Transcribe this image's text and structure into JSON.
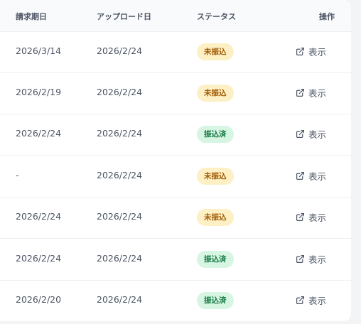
{
  "table": {
    "headers": {
      "due_date": "請求期日",
      "upload_date": "アップロード日",
      "status": "ステータス",
      "actions": "操作"
    },
    "rows": [
      {
        "due_date": "2026/3/14",
        "upload_date": "2026/2/24",
        "status": "未振込",
        "status_kind": "pending",
        "action_label": "表示"
      },
      {
        "due_date": "2026/2/19",
        "upload_date": "2026/2/24",
        "status": "未振込",
        "status_kind": "pending",
        "action_label": "表示"
      },
      {
        "due_date": "2026/2/24",
        "upload_date": "2026/2/24",
        "status": "振込済",
        "status_kind": "paid",
        "action_label": "表示"
      },
      {
        "due_date": "-",
        "upload_date": "2026/2/24",
        "status": "未振込",
        "status_kind": "pending",
        "action_label": "表示"
      },
      {
        "due_date": "2026/2/24",
        "upload_date": "2026/2/24",
        "status": "未振込",
        "status_kind": "pending",
        "action_label": "表示"
      },
      {
        "due_date": "2026/2/24",
        "upload_date": "2026/2/24",
        "status": "振込済",
        "status_kind": "paid",
        "action_label": "表示"
      },
      {
        "due_date": "2026/2/20",
        "upload_date": "2026/2/24",
        "status": "振込済",
        "status_kind": "paid",
        "action_label": "表示"
      }
    ]
  },
  "colors": {
    "pending_bg": "#fdf0c4",
    "pending_text": "#a15c07",
    "paid_bg": "#d6f5e3",
    "paid_text": "#177a44"
  },
  "icons": {
    "action": "external-link-icon"
  }
}
